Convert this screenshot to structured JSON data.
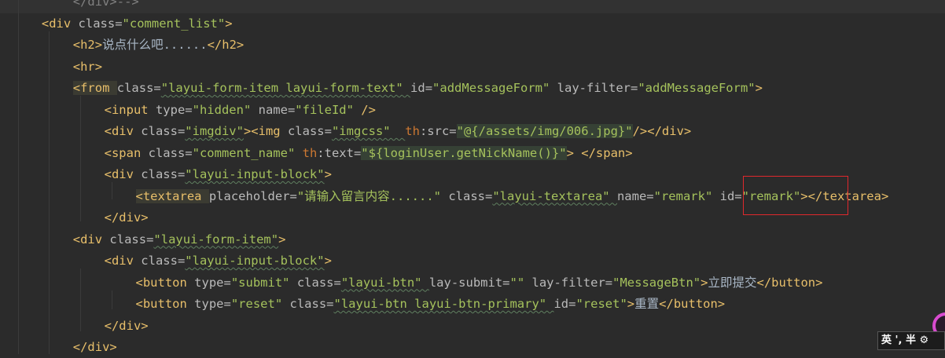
{
  "editor": {
    "lines": [
      {
        "indent": "        ",
        "parts": [
          [
            "cmt",
            "</div>-->"
          ]
        ]
      },
      {
        "indent": "    ",
        "parts": [
          [
            "tag",
            "<div "
          ],
          [
            "attr",
            "class="
          ],
          [
            "val",
            "\"comment_list\""
          ],
          [
            "tag",
            ">"
          ]
        ]
      },
      {
        "indent": "        ",
        "parts": [
          [
            "tag",
            "<h2>"
          ],
          [
            "txt",
            "说点什么吧......"
          ],
          [
            "tag",
            "</h2>"
          ]
        ]
      },
      {
        "indent": "        ",
        "parts": [
          [
            "tag",
            "<hr>"
          ]
        ]
      },
      {
        "indent": "        ",
        "parts": [
          [
            "tag",
            "<from "
          ],
          [
            "attr",
            "class="
          ],
          [
            "val",
            "\"layui-form-item layui-form-text\" "
          ],
          [
            "attr",
            "id="
          ],
          [
            "val",
            "\"addMessageForm\" "
          ],
          [
            "attr",
            "lay-filter="
          ],
          [
            "val",
            "\"addMessageForm\""
          ],
          [
            "tag",
            ">"
          ]
        ]
      },
      {
        "indent": "            ",
        "parts": [
          [
            "tag",
            "<input "
          ],
          [
            "attr",
            "type="
          ],
          [
            "val",
            "\"hidden\" "
          ],
          [
            "attr",
            "name="
          ],
          [
            "val",
            "\"fileId\" "
          ],
          [
            "tag",
            "/>"
          ]
        ]
      },
      {
        "indent": "            ",
        "parts": [
          [
            "tag",
            "<div "
          ],
          [
            "attr",
            "class="
          ],
          [
            "val",
            "\"imgdiv\""
          ],
          [
            "tag",
            "><img "
          ],
          [
            "attr",
            "class="
          ],
          [
            "val",
            "\"imgcss\"  "
          ],
          [
            "ns",
            "th"
          ],
          [
            "attr",
            ":src="
          ],
          [
            "val",
            "\"@{/assets/img/006.jpg}\""
          ],
          [
            "tag",
            "/></div>"
          ]
        ]
      },
      {
        "indent": "            ",
        "parts": [
          [
            "tag",
            "<span "
          ],
          [
            "attr",
            "class="
          ],
          [
            "val",
            "\"comment_name\" "
          ],
          [
            "ns",
            "th"
          ],
          [
            "attr",
            ":text="
          ],
          [
            "val",
            "\"${loginUser.getNickName()}\""
          ],
          [
            "tag",
            "> </span>"
          ]
        ]
      },
      {
        "indent": "            ",
        "parts": [
          [
            "tag",
            "<div "
          ],
          [
            "attr",
            "class="
          ],
          [
            "val",
            "\"layui-input-block\""
          ],
          [
            "tag",
            ">"
          ]
        ]
      },
      {
        "indent": "                ",
        "parts": [
          [
            "tag",
            "<textarea "
          ],
          [
            "attr",
            "placeholder="
          ],
          [
            "val",
            "\"请输入留言内容......\" "
          ],
          [
            "attr",
            "class="
          ],
          [
            "val",
            "\"layui-textarea\" "
          ],
          [
            "attr",
            "name="
          ],
          [
            "val",
            "\"remark\" "
          ],
          [
            "attr",
            "id="
          ],
          [
            "val",
            "\"remark\""
          ],
          [
            "tag",
            "></textarea>"
          ]
        ]
      },
      {
        "indent": "            ",
        "parts": [
          [
            "tag",
            "</div>"
          ]
        ]
      },
      {
        "indent": "        ",
        "parts": [
          [
            "tag",
            "<div "
          ],
          [
            "attr",
            "class="
          ],
          [
            "val",
            "\"layui-form-item\""
          ],
          [
            "tag",
            ">"
          ]
        ]
      },
      {
        "indent": "            ",
        "parts": [
          [
            "tag",
            "<div "
          ],
          [
            "attr",
            "class="
          ],
          [
            "val",
            "\"layui-input-block\""
          ],
          [
            "tag",
            ">"
          ]
        ]
      },
      {
        "indent": "                ",
        "parts": [
          [
            "tag",
            "<button "
          ],
          [
            "attr",
            "type="
          ],
          [
            "val",
            "\"submit\" "
          ],
          [
            "attr",
            "class="
          ],
          [
            "val",
            "\"layui-btn\" "
          ],
          [
            "attr",
            "lay-submit="
          ],
          [
            "val",
            "\"\" "
          ],
          [
            "attr",
            "lay-filter="
          ],
          [
            "val",
            "\"MessageBtn\""
          ],
          [
            "tag",
            ">"
          ],
          [
            "txt",
            "立即提交"
          ],
          [
            "tag",
            "</button>"
          ]
        ]
      },
      {
        "indent": "                ",
        "parts": [
          [
            "tag",
            "<button "
          ],
          [
            "attr",
            "type="
          ],
          [
            "val",
            "\"reset\" "
          ],
          [
            "attr",
            "class="
          ],
          [
            "val",
            "\"layui-btn layui-btn-primary\" "
          ],
          [
            "attr",
            "id="
          ],
          [
            "val",
            "\"reset\""
          ],
          [
            "tag",
            ">"
          ],
          [
            "txt",
            "重置"
          ],
          [
            "tag",
            "</button>"
          ]
        ]
      },
      {
        "indent": "            ",
        "parts": [
          [
            "tag",
            "</div>"
          ]
        ]
      },
      {
        "indent": "        ",
        "parts": [
          [
            "tag",
            "</div>"
          ]
        ]
      }
    ]
  },
  "ime": {
    "label": "英 ', 半 ⚙"
  },
  "colors": {
    "background": "#2b2b2b",
    "tag": "#e8bf6a",
    "attribute": "#bababa",
    "value": "#a5c25c",
    "highlight_box": "#e0282d"
  }
}
